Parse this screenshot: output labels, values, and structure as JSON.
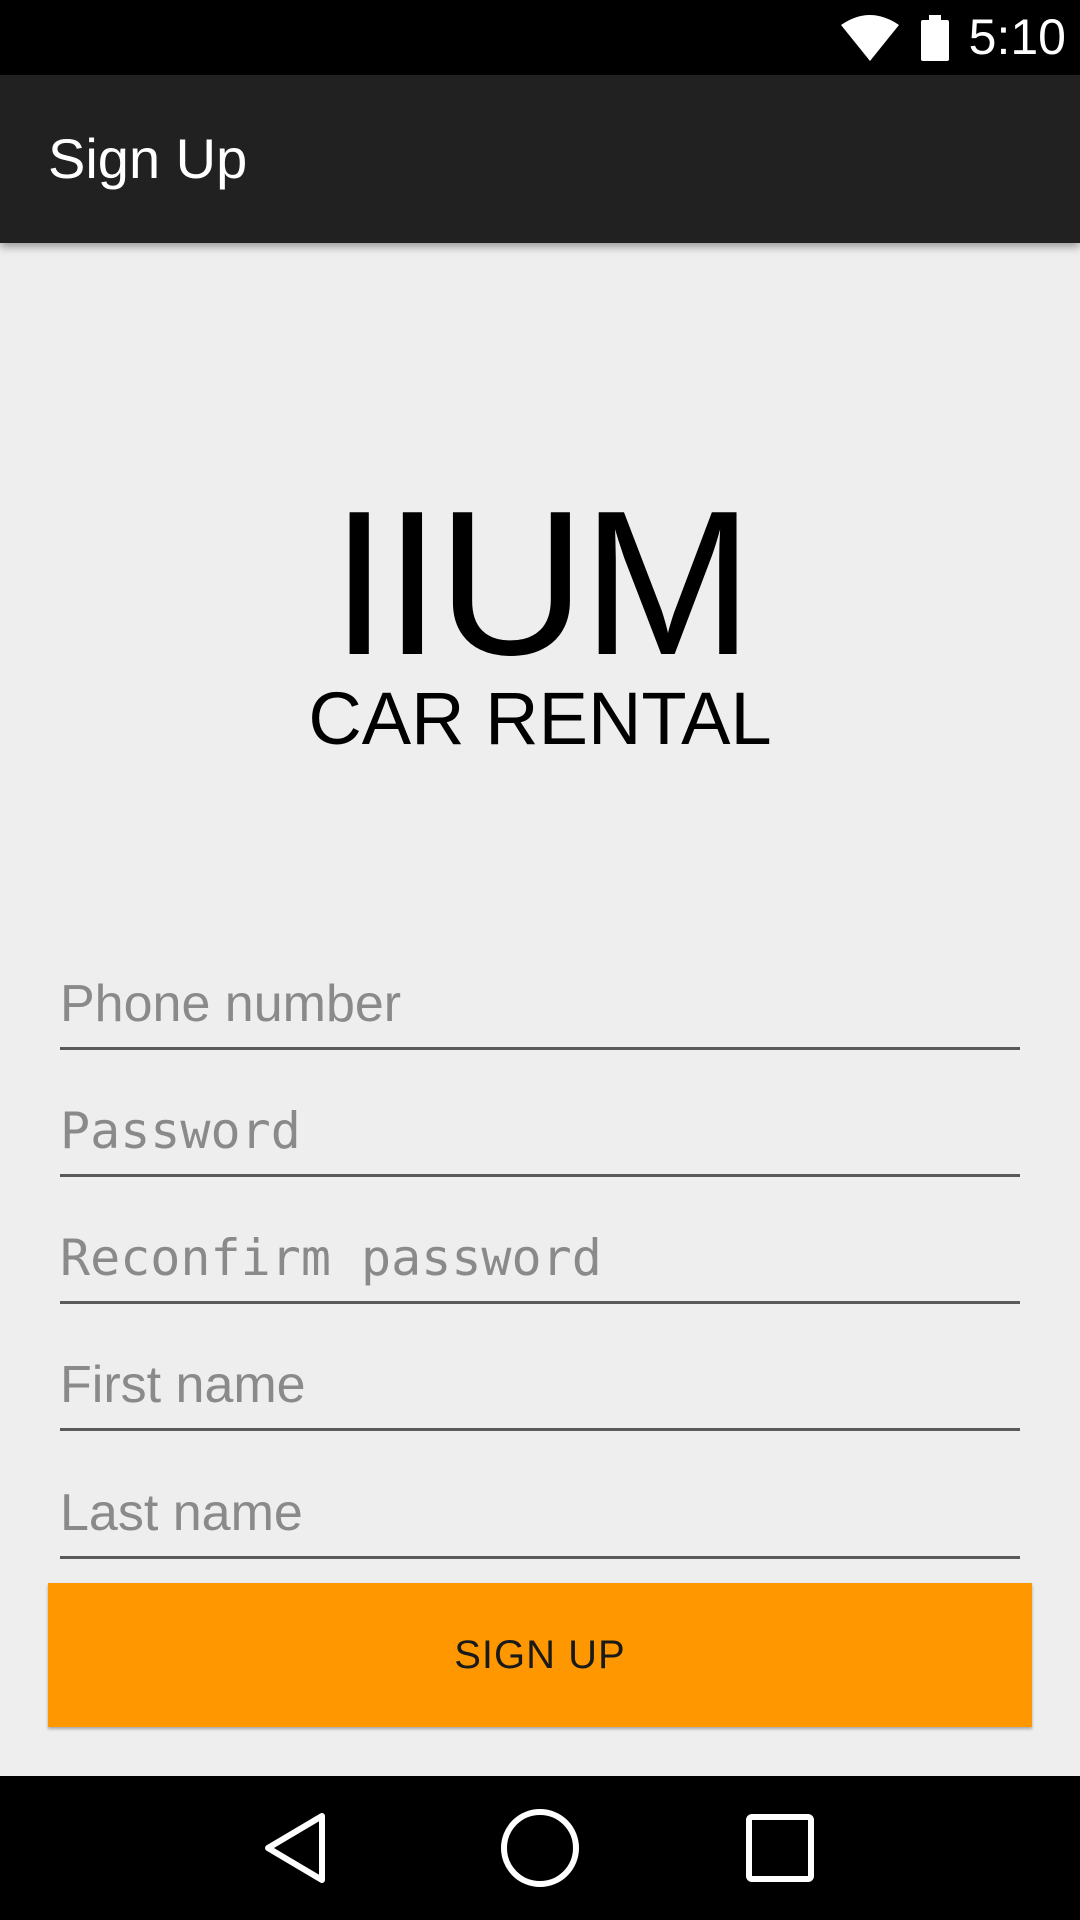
{
  "status_bar": {
    "time": "5:10",
    "icons": [
      "wifi-icon",
      "battery-icon"
    ]
  },
  "app_bar": {
    "title": "Sign Up"
  },
  "logo": {
    "main": "IIUM",
    "sub": "CAR RENTAL"
  },
  "form": {
    "phone_placeholder": "Phone number",
    "password_placeholder": "Password",
    "reconfirm_placeholder": "Reconfirm password",
    "first_name_placeholder": "First name",
    "last_name_placeholder": "Last name",
    "submit_label": "SIGN UP"
  },
  "nav_bar": {
    "icons": [
      "back-icon",
      "home-icon",
      "recents-icon"
    ]
  },
  "colors": {
    "status_bar": "#000000",
    "app_bar": "#212121",
    "background": "#eeeeee",
    "accent": "#ff9800",
    "nav_bar": "#000000"
  }
}
